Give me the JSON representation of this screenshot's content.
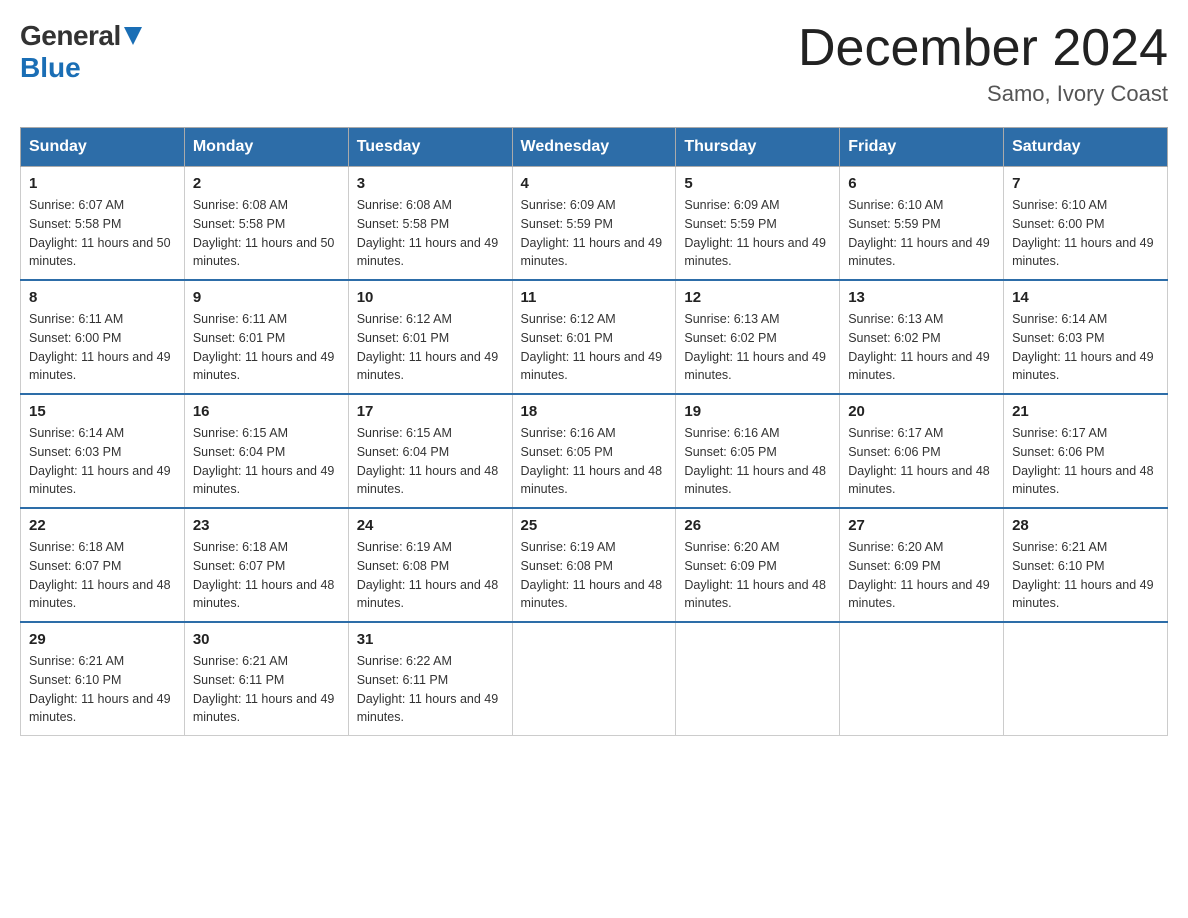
{
  "logo": {
    "general": "General",
    "blue": "Blue"
  },
  "title": "December 2024",
  "subtitle": "Samo, Ivory Coast",
  "days_of_week": [
    "Sunday",
    "Monday",
    "Tuesday",
    "Wednesday",
    "Thursday",
    "Friday",
    "Saturday"
  ],
  "weeks": [
    [
      {
        "day": "1",
        "sunrise": "6:07 AM",
        "sunset": "5:58 PM",
        "daylight": "11 hours and 50 minutes."
      },
      {
        "day": "2",
        "sunrise": "6:08 AM",
        "sunset": "5:58 PM",
        "daylight": "11 hours and 50 minutes."
      },
      {
        "day": "3",
        "sunrise": "6:08 AM",
        "sunset": "5:58 PM",
        "daylight": "11 hours and 49 minutes."
      },
      {
        "day": "4",
        "sunrise": "6:09 AM",
        "sunset": "5:59 PM",
        "daylight": "11 hours and 49 minutes."
      },
      {
        "day": "5",
        "sunrise": "6:09 AM",
        "sunset": "5:59 PM",
        "daylight": "11 hours and 49 minutes."
      },
      {
        "day": "6",
        "sunrise": "6:10 AM",
        "sunset": "5:59 PM",
        "daylight": "11 hours and 49 minutes."
      },
      {
        "day": "7",
        "sunrise": "6:10 AM",
        "sunset": "6:00 PM",
        "daylight": "11 hours and 49 minutes."
      }
    ],
    [
      {
        "day": "8",
        "sunrise": "6:11 AM",
        "sunset": "6:00 PM",
        "daylight": "11 hours and 49 minutes."
      },
      {
        "day": "9",
        "sunrise": "6:11 AM",
        "sunset": "6:01 PM",
        "daylight": "11 hours and 49 minutes."
      },
      {
        "day": "10",
        "sunrise": "6:12 AM",
        "sunset": "6:01 PM",
        "daylight": "11 hours and 49 minutes."
      },
      {
        "day": "11",
        "sunrise": "6:12 AM",
        "sunset": "6:01 PM",
        "daylight": "11 hours and 49 minutes."
      },
      {
        "day": "12",
        "sunrise": "6:13 AM",
        "sunset": "6:02 PM",
        "daylight": "11 hours and 49 minutes."
      },
      {
        "day": "13",
        "sunrise": "6:13 AM",
        "sunset": "6:02 PM",
        "daylight": "11 hours and 49 minutes."
      },
      {
        "day": "14",
        "sunrise": "6:14 AM",
        "sunset": "6:03 PM",
        "daylight": "11 hours and 49 minutes."
      }
    ],
    [
      {
        "day": "15",
        "sunrise": "6:14 AM",
        "sunset": "6:03 PM",
        "daylight": "11 hours and 49 minutes."
      },
      {
        "day": "16",
        "sunrise": "6:15 AM",
        "sunset": "6:04 PM",
        "daylight": "11 hours and 49 minutes."
      },
      {
        "day": "17",
        "sunrise": "6:15 AM",
        "sunset": "6:04 PM",
        "daylight": "11 hours and 48 minutes."
      },
      {
        "day": "18",
        "sunrise": "6:16 AM",
        "sunset": "6:05 PM",
        "daylight": "11 hours and 48 minutes."
      },
      {
        "day": "19",
        "sunrise": "6:16 AM",
        "sunset": "6:05 PM",
        "daylight": "11 hours and 48 minutes."
      },
      {
        "day": "20",
        "sunrise": "6:17 AM",
        "sunset": "6:06 PM",
        "daylight": "11 hours and 48 minutes."
      },
      {
        "day": "21",
        "sunrise": "6:17 AM",
        "sunset": "6:06 PM",
        "daylight": "11 hours and 48 minutes."
      }
    ],
    [
      {
        "day": "22",
        "sunrise": "6:18 AM",
        "sunset": "6:07 PM",
        "daylight": "11 hours and 48 minutes."
      },
      {
        "day": "23",
        "sunrise": "6:18 AM",
        "sunset": "6:07 PM",
        "daylight": "11 hours and 48 minutes."
      },
      {
        "day": "24",
        "sunrise": "6:19 AM",
        "sunset": "6:08 PM",
        "daylight": "11 hours and 48 minutes."
      },
      {
        "day": "25",
        "sunrise": "6:19 AM",
        "sunset": "6:08 PM",
        "daylight": "11 hours and 48 minutes."
      },
      {
        "day": "26",
        "sunrise": "6:20 AM",
        "sunset": "6:09 PM",
        "daylight": "11 hours and 48 minutes."
      },
      {
        "day": "27",
        "sunrise": "6:20 AM",
        "sunset": "6:09 PM",
        "daylight": "11 hours and 49 minutes."
      },
      {
        "day": "28",
        "sunrise": "6:21 AM",
        "sunset": "6:10 PM",
        "daylight": "11 hours and 49 minutes."
      }
    ],
    [
      {
        "day": "29",
        "sunrise": "6:21 AM",
        "sunset": "6:10 PM",
        "daylight": "11 hours and 49 minutes."
      },
      {
        "day": "30",
        "sunrise": "6:21 AM",
        "sunset": "6:11 PM",
        "daylight": "11 hours and 49 minutes."
      },
      {
        "day": "31",
        "sunrise": "6:22 AM",
        "sunset": "6:11 PM",
        "daylight": "11 hours and 49 minutes."
      },
      null,
      null,
      null,
      null
    ]
  ]
}
